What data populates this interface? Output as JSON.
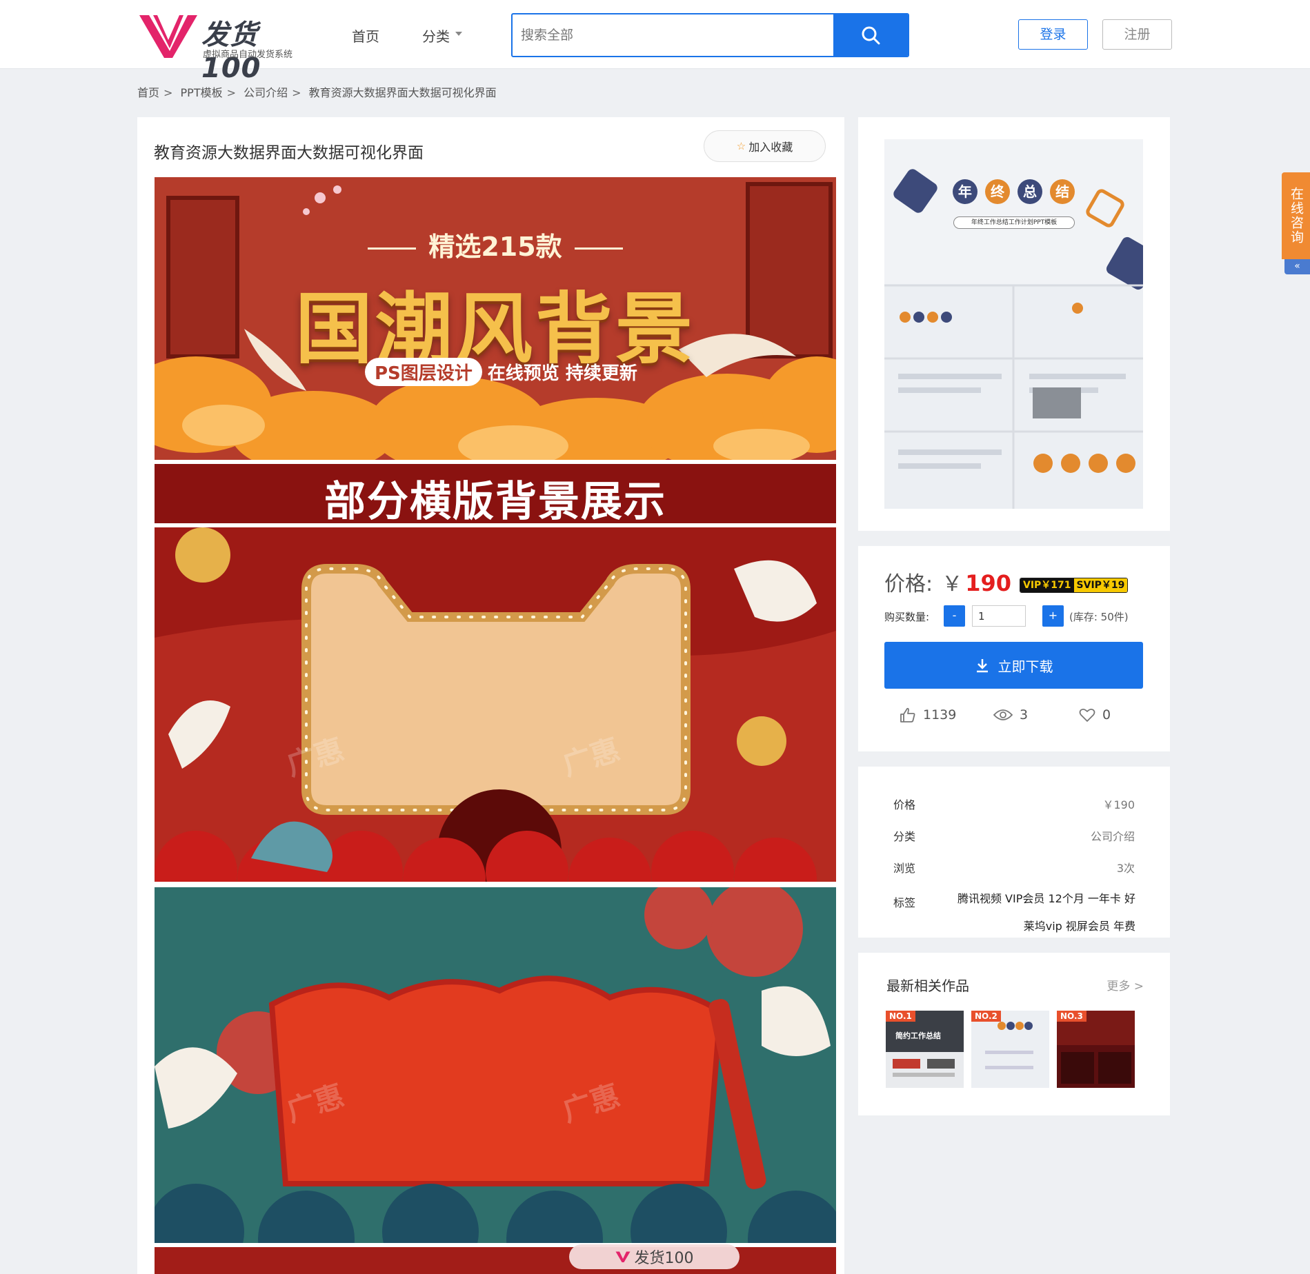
{
  "header": {
    "logo_title": "发货100",
    "logo_sub": "虚拟商品自动发货系统",
    "nav": {
      "home": "首页",
      "category": "分类"
    },
    "search_placeholder": "搜索全部",
    "login": "登录",
    "register": "注册"
  },
  "breadcrumb": [
    "首页",
    "PPT模板",
    "公司介绍",
    "教育资源大数据界面大数据可视化界面"
  ],
  "breadcrumb_sep": ">",
  "product": {
    "title": "教育资源大数据界面大数据可视化界面",
    "favorite": "加入收藏",
    "banner": {
      "sub": "精选215款",
      "main": "国潮风背景",
      "pill": "PS图层设计",
      "tagline": "在线预览 持续更新",
      "section": "部分横版背景展示",
      "watermark": "广惠"
    },
    "float_badge": "发货100"
  },
  "preview": {
    "title_chars": [
      "年",
      "终",
      "总",
      "结"
    ],
    "subtitle": "年终工作总结工作计划PPT模板"
  },
  "buy": {
    "price_label": "价格:",
    "currency": "￥",
    "price": "190",
    "vip": "VIP￥171",
    "svip": "SVIP￥19",
    "qty_label": "购买数量:",
    "minus": "-",
    "plus": "+",
    "qty_value": "1",
    "stock": "(库存: 50件)",
    "download": "立即下载",
    "likes": "1139",
    "views": "3",
    "favorites": "0"
  },
  "info": {
    "price_k": "价格",
    "price_v": "￥190",
    "cat_k": "分类",
    "cat_v": "公司介绍",
    "views_k": "浏览",
    "views_v": "3次",
    "tags_k": "标签",
    "tags_line1": "腾讯视频 VIP会员 12个月 一年卡 好",
    "tags_line2": "莱坞vip 视屏会员 年费"
  },
  "related": {
    "title": "最新相关作品",
    "more": "更多 >",
    "items": [
      {
        "no": "NO.1",
        "title": "简约工作总结"
      },
      {
        "no": "NO.2"
      },
      {
        "no": "NO.3"
      }
    ]
  },
  "consult": {
    "label": "在线咨询",
    "arrow": "«"
  },
  "colors": {
    "accent": "#1a73e8",
    "price": "#e41e1e",
    "brand": "#e3246a",
    "consult": "#f08a32"
  }
}
